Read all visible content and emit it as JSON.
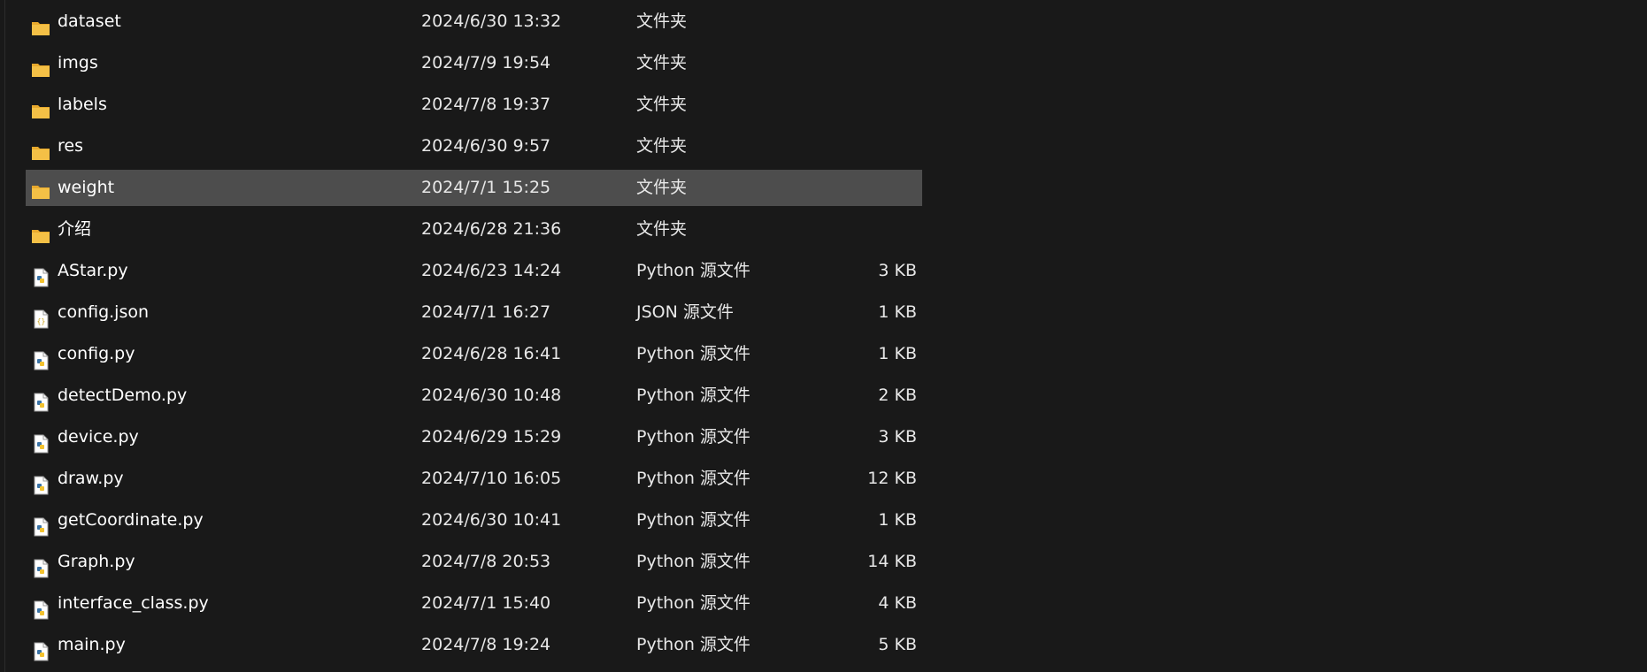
{
  "colors": {
    "background": "#191919",
    "selected_row": "#4d4d4d",
    "folder": "#f4c046",
    "python_blue": "#3b74a8",
    "json_yellow": "#c9a21a"
  },
  "files": [
    {
      "name": "dataset",
      "date": "2024/6/30 13:32",
      "type": "文件夹",
      "size": "",
      "icon": "folder-icon",
      "selected": false
    },
    {
      "name": "imgs",
      "date": "2024/7/9 19:54",
      "type": "文件夹",
      "size": "",
      "icon": "folder-icon",
      "selected": false
    },
    {
      "name": "labels",
      "date": "2024/7/8 19:37",
      "type": "文件夹",
      "size": "",
      "icon": "folder-icon",
      "selected": false
    },
    {
      "name": "res",
      "date": "2024/6/30 9:57",
      "type": "文件夹",
      "size": "",
      "icon": "folder-icon",
      "selected": false
    },
    {
      "name": "weight",
      "date": "2024/7/1 15:25",
      "type": "文件夹",
      "size": "",
      "icon": "folder-icon",
      "selected": true
    },
    {
      "name": "介绍",
      "date": "2024/6/28 21:36",
      "type": "文件夹",
      "size": "",
      "icon": "folder-icon",
      "selected": false
    },
    {
      "name": "AStar.py",
      "date": "2024/6/23 14:24",
      "type": "Python 源文件",
      "size": "3 KB",
      "icon": "python-file-icon",
      "selected": false
    },
    {
      "name": "config.json",
      "date": "2024/7/1 16:27",
      "type": "JSON 源文件",
      "size": "1 KB",
      "icon": "json-file-icon",
      "selected": false
    },
    {
      "name": "config.py",
      "date": "2024/6/28 16:41",
      "type": "Python 源文件",
      "size": "1 KB",
      "icon": "python-file-icon",
      "selected": false
    },
    {
      "name": "detectDemo.py",
      "date": "2024/6/30 10:48",
      "type": "Python 源文件",
      "size": "2 KB",
      "icon": "python-file-icon",
      "selected": false
    },
    {
      "name": "device.py",
      "date": "2024/6/29 15:29",
      "type": "Python 源文件",
      "size": "3 KB",
      "icon": "python-file-icon",
      "selected": false
    },
    {
      "name": "draw.py",
      "date": "2024/7/10 16:05",
      "type": "Python 源文件",
      "size": "12 KB",
      "icon": "python-file-icon",
      "selected": false
    },
    {
      "name": "getCoordinate.py",
      "date": "2024/6/30 10:41",
      "type": "Python 源文件",
      "size": "1 KB",
      "icon": "python-file-icon",
      "selected": false
    },
    {
      "name": "Graph.py",
      "date": "2024/7/8 20:53",
      "type": "Python 源文件",
      "size": "14 KB",
      "icon": "python-file-icon",
      "selected": false
    },
    {
      "name": "interface_class.py",
      "date": "2024/7/1 15:40",
      "type": "Python 源文件",
      "size": "4 KB",
      "icon": "python-file-icon",
      "selected": false
    },
    {
      "name": "main.py",
      "date": "2024/7/8 19:24",
      "type": "Python 源文件",
      "size": "5 KB",
      "icon": "python-file-icon",
      "selected": false
    }
  ]
}
